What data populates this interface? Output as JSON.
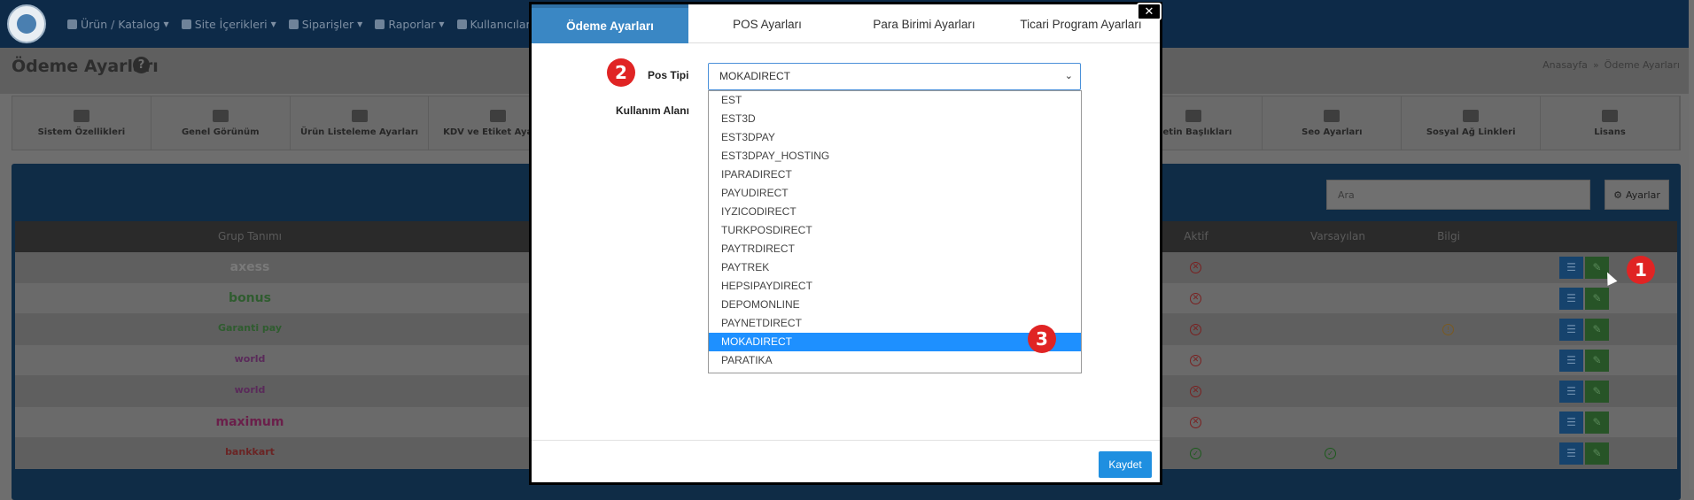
{
  "nav": {
    "items": [
      "Ürün / Katalog",
      "Site İçerikleri",
      "Siparişler",
      "Raporlar",
      "Kullanıcılar"
    ]
  },
  "page": {
    "title": "Ödeme Ayarları",
    "breadcrumb_home": "Anasayfa",
    "breadcrumb_sep": "»",
    "breadcrumb_current": "Ödeme Ayarları"
  },
  "settings_tabs": [
    "Sistem Özellikleri",
    "Genel Görünüm",
    "Ürün Listeleme Ayarları",
    "KDV ve Etiket Ayarları",
    "",
    "",
    "",
    "",
    "Metin Başlıkları",
    "Seo Ayarları",
    "Sosyal Ağ Linkleri",
    "Lisans"
  ],
  "panel": {
    "search_placeholder": "Ara",
    "settings_button": "Ayarlar",
    "columns": [
      "Grup Tanımı",
      "Aktif",
      "Varsayılan",
      "Bilgi"
    ],
    "rows": [
      {
        "brand": "axess",
        "color": "#7a7a7a"
      },
      {
        "brand": "bonus",
        "color": "#2f5c2f"
      },
      {
        "brand": "Garanti pay",
        "color": "#2f5c2f"
      },
      {
        "brand": "world",
        "color": "#5a2a5a"
      },
      {
        "brand": "world",
        "color": "#5a2a5a"
      },
      {
        "brand": "maximum",
        "color": "#6a1f4a"
      },
      {
        "brand": "bankkart",
        "color": "#6a2424"
      }
    ]
  },
  "modal": {
    "tabs": [
      "Ödeme Ayarları",
      "POS Ayarları",
      "Para Birimi Ayarları",
      "Ticari Program Ayarları"
    ],
    "close_label": "✕",
    "pos_label": "Pos Tipi",
    "usage_label": "Kullanım Alanı",
    "selected_pos": "MOKADIRECT",
    "options": [
      "EST",
      "EST3D",
      "EST3DPAY",
      "EST3DPAY_HOSTING",
      "IPARADIRECT",
      "PAYUDIRECT",
      "IYZICODIRECT",
      "TURKPOSDIRECT",
      "PAYTRDIRECT",
      "PAYTREK",
      "HEPSIPAYDIRECT",
      "DEPOMONLINE",
      "PAYNETDIRECT",
      "MOKADIRECT",
      "PARATIKA"
    ],
    "save_label": "Kaydet"
  },
  "markers": [
    "1",
    "2",
    "3"
  ],
  "colors": {
    "accent": "#3a87c4",
    "marker": "#e02424",
    "selected_option": "#1e90ff",
    "save_button": "#1f8fe0"
  }
}
